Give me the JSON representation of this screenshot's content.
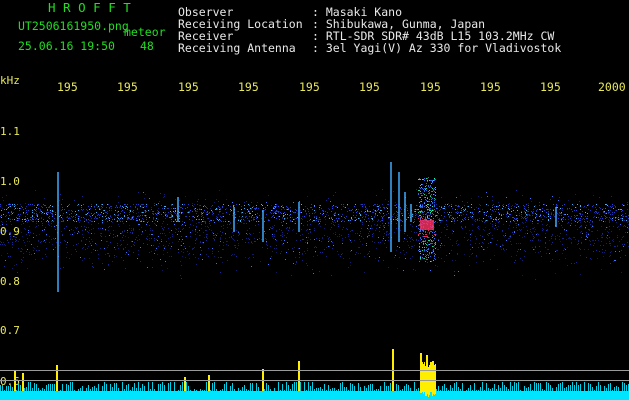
{
  "header": {
    "brand": "H R O F F T",
    "filename": "UT2506161950.png",
    "meteor_label": "meteor",
    "datetime": "25.06.16 19:50",
    "count": "48",
    "observer_label": "Observer",
    "observer_value": ": Masaki Kano",
    "location_label": "Receiving Location",
    "location_value": ": Shibukawa, Gunma, Japan",
    "receiver_label": "Receiver",
    "receiver_value": ": RTL-SDR SDR# 43dB L15 103.2MHz CW",
    "antenna_label": "Receiving Antenna",
    "antenna_value": ": 3el Yagi(V) Az 330 for Vladivostok"
  },
  "y_axis": {
    "unit": "kHz",
    "ticks": [
      "1.1",
      "1.0",
      "0.9",
      "0.8",
      "0.7",
      "0.6"
    ]
  },
  "x_axis": {
    "ticks": [
      "195",
      "195",
      "195",
      "195",
      "195",
      "195",
      "195",
      "195",
      "195",
      "2000"
    ]
  },
  "colors": {
    "background": "#000000",
    "axis_text": "#e8e85a",
    "title_green": "#22dd22",
    "signal_band": "#2a4dff",
    "meteor_highlight": "#ff3366",
    "level_cyan": "#00e5ff",
    "level_yellow": "#ffee00"
  }
}
